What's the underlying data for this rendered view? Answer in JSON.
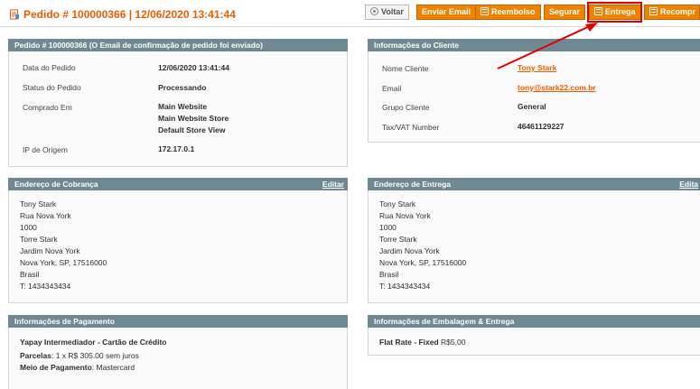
{
  "header": {
    "title": "Pedido # 100000366 | 12/06/2020 13:41:44",
    "buttons": {
      "back": "Voltar",
      "send_email": "Enviar Email",
      "refund": "Reembolso",
      "hold": "Segurar",
      "ship": "Entrega",
      "reorder": "Recompr"
    }
  },
  "order_box": {
    "title": "Pedido # 100000366 (O Email de confirmação de pedido foi enviado)",
    "rows": [
      {
        "label": "Data do Pedido",
        "value": "12/06/2020 13:41:44"
      },
      {
        "label": "Status do Pedido",
        "value": "Processando"
      },
      {
        "label": "Comprado Em",
        "value_lines": [
          "Main Website",
          "Main Website Store",
          "Default Store View"
        ]
      },
      {
        "label": "IP de Origem",
        "value": "172.17.0.1"
      }
    ]
  },
  "customer_box": {
    "title": "Informações do Cliente",
    "rows": [
      {
        "label": "Nome Cliente",
        "value": "Tony Stark"
      },
      {
        "label": "Email",
        "value": "tony@stark22.com.br"
      },
      {
        "label": "Grupo Cliente",
        "value": "General"
      },
      {
        "label": "Tax/VAT Number",
        "value": "46461129227"
      }
    ]
  },
  "billing_box": {
    "title": "Endereço de Cobrança",
    "edit": "Editar",
    "lines": [
      "Tony Stark",
      "Rua Nova York",
      "1000",
      "Torre Stark",
      "Jardim Nova York",
      "Nova York, SP, 17516000",
      "Brasil",
      "T: 1434343434"
    ]
  },
  "shipping_box": {
    "title": "Endereço de Entrega",
    "edit": "Edita",
    "lines": [
      "Tony Stark",
      "Rua Nova York",
      "1000",
      "Torre Stark",
      "Jardim Nova York",
      "Nova York, SP, 17516000",
      "Brasil",
      "T: 1434343434"
    ]
  },
  "payment_box": {
    "title": "Informações de Pagamento",
    "method": "Yapay Intermediador - Cartão de Crédito",
    "installments_label": "Parcelas",
    "installments_value": ": 1 x R$ 305.00 sem juros",
    "payment_label": "Meio de Pagamento",
    "payment_value": ": Mastercard"
  },
  "shipping_method_box": {
    "title": "Informações de Embalagem & Entrega",
    "method": "Flat Rate - Fixed",
    "price": " R$5,00"
  },
  "colors": {
    "accent": "#eb5e00",
    "button": "#f18200",
    "box_header": "#6f8992",
    "annotation": "#e00000"
  }
}
